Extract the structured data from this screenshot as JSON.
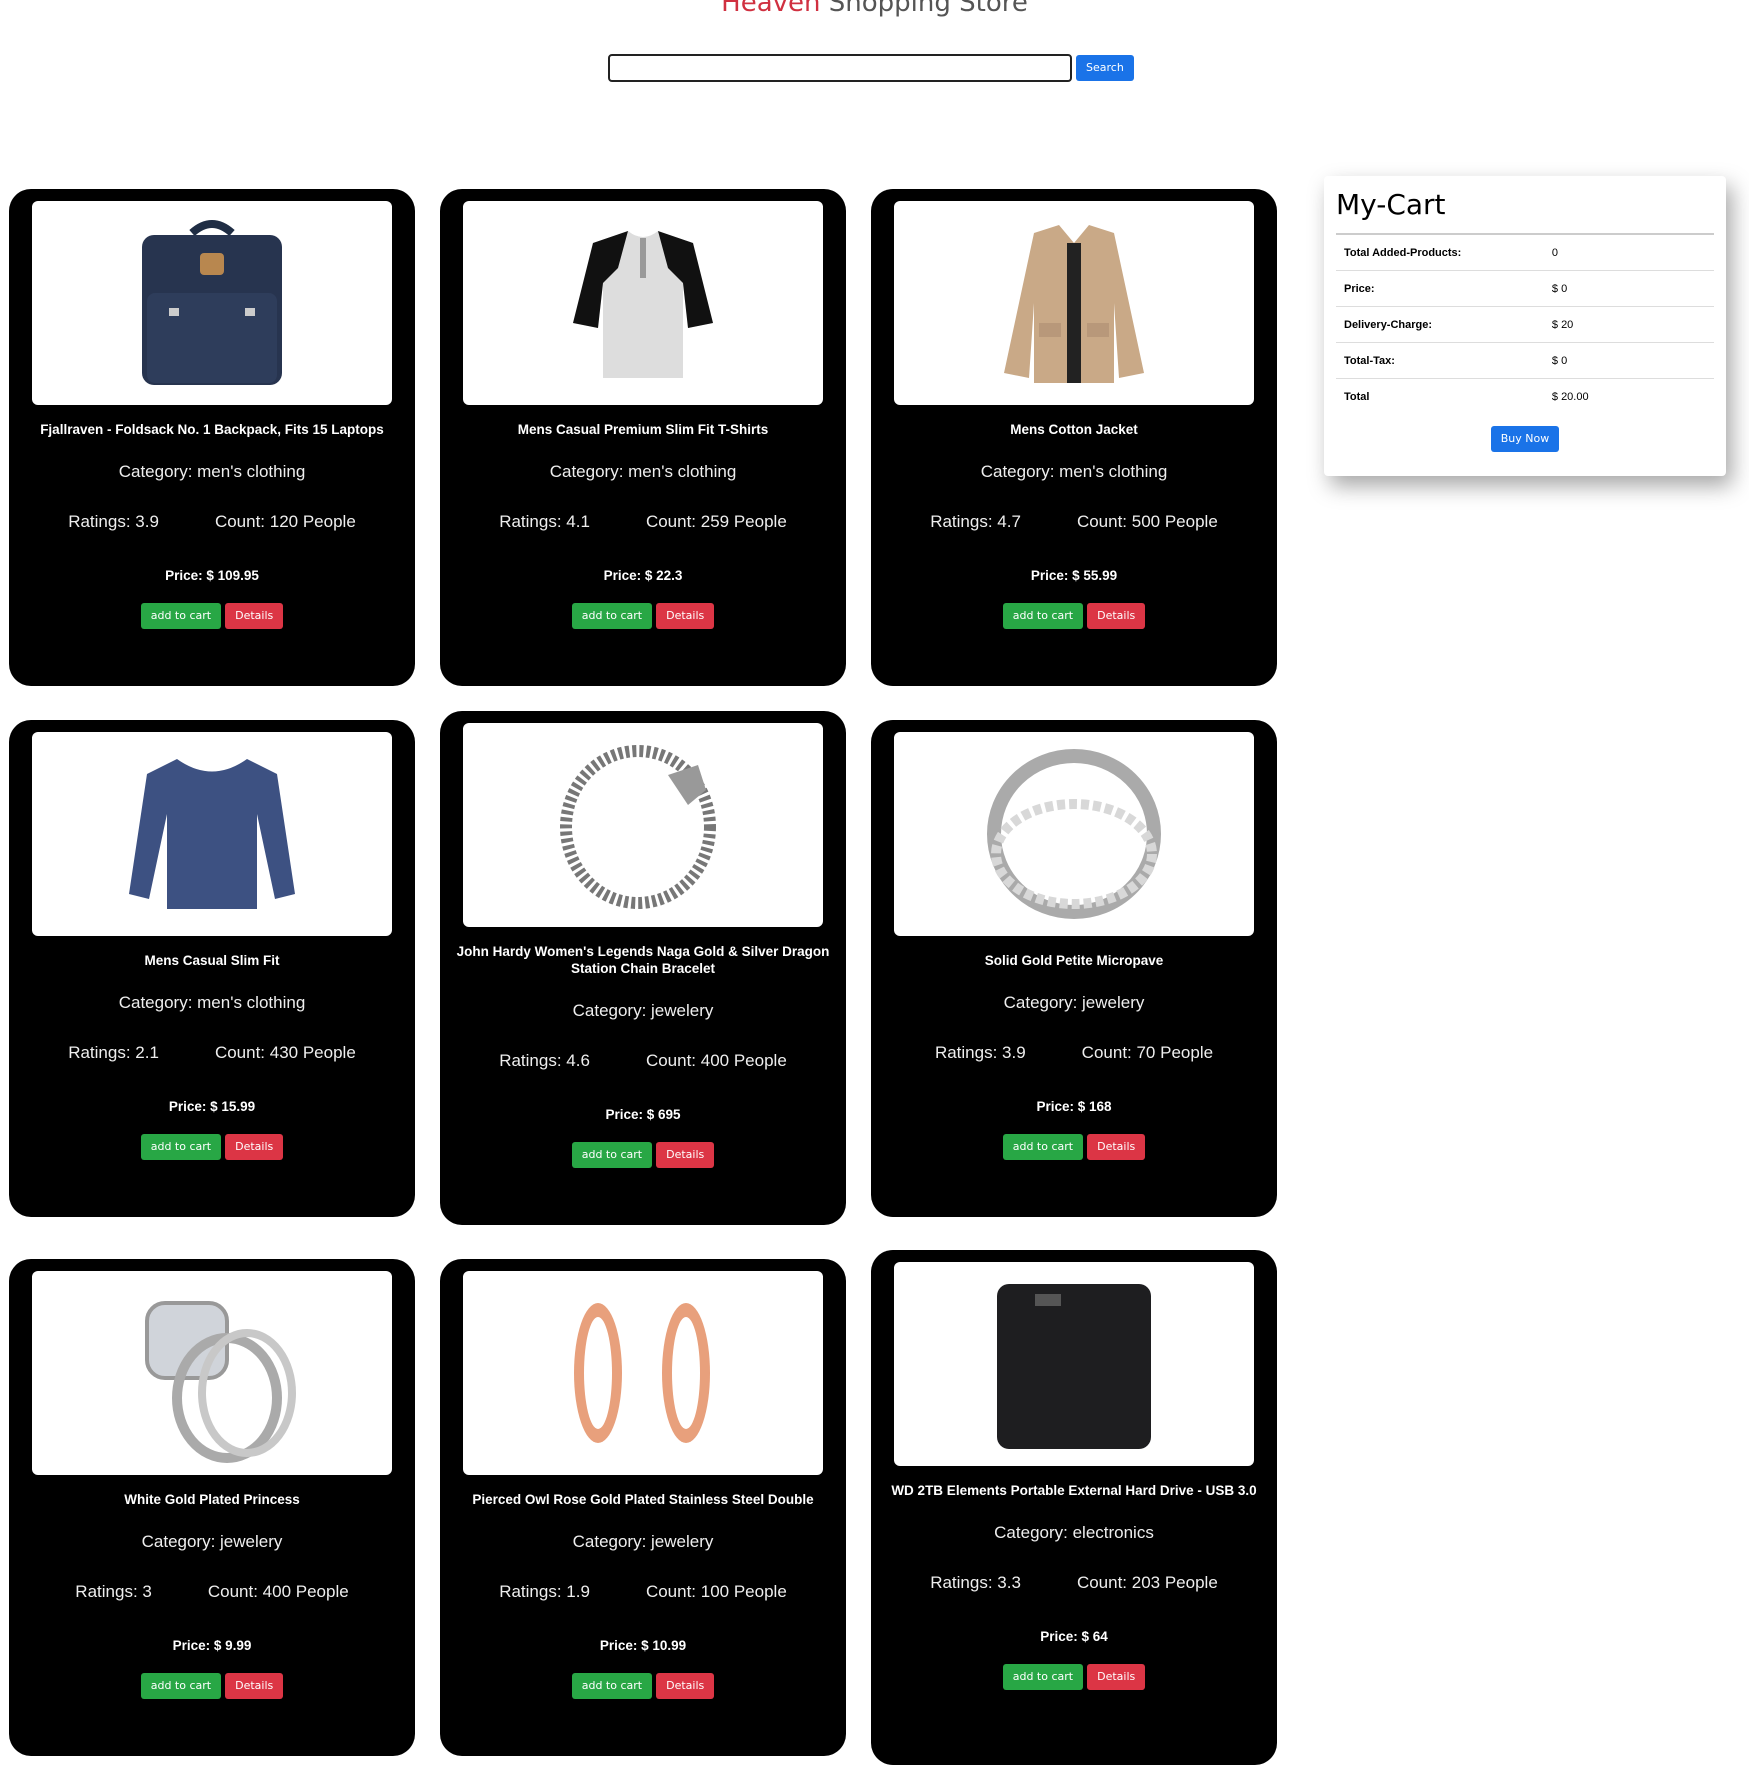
{
  "header": {
    "brand": "Heaven",
    "title_rest": "Shopping Store",
    "search_placeholder": "",
    "search_button": "Search"
  },
  "products": [
    {
      "title": "Fjallraven - Foldsack No. 1 Backpack, Fits 15 Laptops",
      "category": "Category: men's clothing",
      "ratings": "Ratings: 3.9",
      "count": "Count: 120 People",
      "price": "Price: $ 109.95",
      "add": "add to cart",
      "details": "Details",
      "icon": "backpack-icon"
    },
    {
      "title": "Mens Casual Premium Slim Fit T-Shirts",
      "category": "Category: men's clothing",
      "ratings": "Ratings: 4.1",
      "count": "Count: 259 People",
      "price": "Price: $ 22.3",
      "add": "add to cart",
      "details": "Details",
      "icon": "tshirt-icon"
    },
    {
      "title": "Mens Cotton Jacket",
      "category": "Category: men's clothing",
      "ratings": "Ratings: 4.7",
      "count": "Count: 500 People",
      "price": "Price: $ 55.99",
      "add": "add to cart",
      "details": "Details",
      "icon": "jacket-icon"
    },
    {
      "title": "Mens Casual Slim Fit",
      "category": "Category: men's clothing",
      "ratings": "Ratings: 2.1",
      "count": "Count: 430 People",
      "price": "Price: $ 15.99",
      "add": "add to cart",
      "details": "Details",
      "icon": "longsleeve-icon"
    },
    {
      "title": "John Hardy Women's Legends Naga Gold & Silver Dragon Station Chain Bracelet",
      "category": "Category: jewelery",
      "ratings": "Ratings: 4.6",
      "count": "Count: 400 People",
      "price": "Price: $ 695",
      "add": "add to cart",
      "details": "Details",
      "icon": "bracelet-icon"
    },
    {
      "title": "Solid Gold Petite Micropave",
      "category": "Category: jewelery",
      "ratings": "Ratings: 3.9",
      "count": "Count: 70 People",
      "price": "Price: $ 168",
      "add": "add to cart",
      "details": "Details",
      "icon": "ring-icon"
    },
    {
      "title": "White Gold Plated Princess",
      "category": "Category: jewelery",
      "ratings": "Ratings: 3",
      "count": "Count: 400 People",
      "price": "Price: $ 9.99",
      "add": "add to cart",
      "details": "Details",
      "icon": "diamond-ring-icon"
    },
    {
      "title": "Pierced Owl Rose Gold Plated Stainless Steel Double",
      "category": "Category: jewelery",
      "ratings": "Ratings: 1.9",
      "count": "Count: 100 People",
      "price": "Price: $ 10.99",
      "add": "add to cart",
      "details": "Details",
      "icon": "ear-plug-icon"
    },
    {
      "title": "WD 2TB Elements Portable External Hard Drive - USB 3.0",
      "category": "Category: electronics",
      "ratings": "Ratings: 3.3",
      "count": "Count: 203 People",
      "price": "Price: $ 64",
      "add": "add to cart",
      "details": "Details",
      "icon": "hard-drive-icon"
    }
  ],
  "cart": {
    "title": "My-Cart",
    "rows": [
      {
        "label": "Total Added-Products:",
        "value": "0"
      },
      {
        "label": "Price:",
        "value": "$ 0"
      },
      {
        "label": "Delivery-Charge:",
        "value": "$ 20"
      },
      {
        "label": "Total-Tax:",
        "value": "$ 0"
      },
      {
        "label": "Total",
        "value": "$ 20.00"
      }
    ],
    "buy_button": "Buy Now"
  },
  "colors": {
    "brand": "#d03040",
    "primary": "#1a73e8",
    "success": "#28a745",
    "danger": "#dc3545"
  }
}
